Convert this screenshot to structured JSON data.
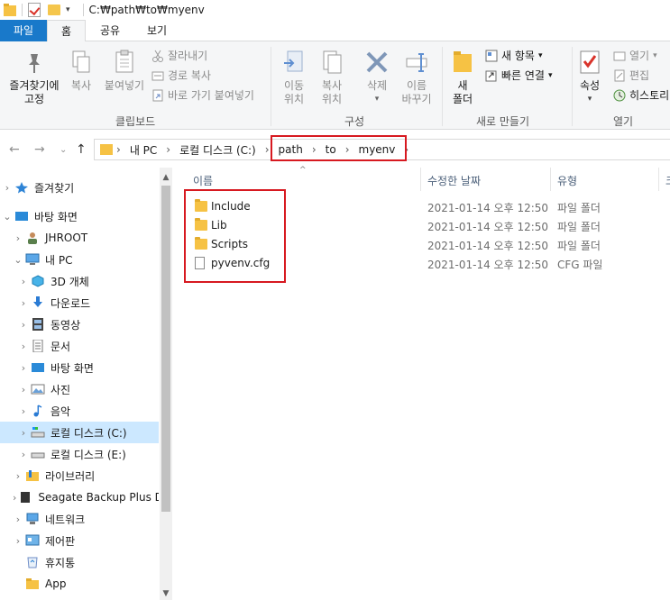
{
  "window": {
    "title": "C:₩path₩to₩myenv"
  },
  "tabs": {
    "file": "파일",
    "home": "홈",
    "share": "공유",
    "view": "보기"
  },
  "ribbon": {
    "clipboard": {
      "label": "클립보드",
      "pin_line1": "즐겨찾기에",
      "pin_line2": "고정",
      "copy": "복사",
      "paste": "붙여넣기",
      "cut": "잘라내기",
      "copy_path": "경로 복사",
      "paste_shortcut": "바로 가기 붙여넣기"
    },
    "organize": {
      "label": "구성",
      "move_line1": "이동",
      "move_line2": "위치",
      "copyto_line1": "복사",
      "copyto_line2": "위치",
      "delete": "삭제",
      "rename_line1": "이름",
      "rename_line2": "바꾸기"
    },
    "new": {
      "label": "새로 만들기",
      "folder_line1": "새",
      "folder_line2": "폴더",
      "new_item": "새 항목",
      "easy_access": "빠른 연결"
    },
    "open": {
      "label": "열기",
      "properties": "속성",
      "open": "열기",
      "edit": "편집",
      "history": "히스토리"
    }
  },
  "address": {
    "crumbs": [
      "내 PC",
      "로컬 디스크 (C:)",
      "path",
      "to",
      "myenv"
    ]
  },
  "nav": {
    "items": [
      {
        "label": "즐겨찾기",
        "icon": "star-icon"
      },
      {
        "label": "바탕 화면",
        "icon": "desktop-icon"
      },
      {
        "label": "JHROOT",
        "icon": "user-icon"
      },
      {
        "label": "내 PC",
        "icon": "computer-icon"
      },
      {
        "label": "3D 개체",
        "icon": "cube-icon"
      },
      {
        "label": "다운로드",
        "icon": "download-icon"
      },
      {
        "label": "동영상",
        "icon": "film-icon"
      },
      {
        "label": "문서",
        "icon": "document-icon"
      },
      {
        "label": "바탕 화면",
        "icon": "desktop-icon"
      },
      {
        "label": "사진",
        "icon": "picture-icon"
      },
      {
        "label": "음악",
        "icon": "music-icon"
      },
      {
        "label": "로컬 디스크 (C:)",
        "icon": "drive-icon"
      },
      {
        "label": "로컬 디스크 (E:)",
        "icon": "drive-icon"
      },
      {
        "label": "라이브러리",
        "icon": "library-icon"
      },
      {
        "label": "Seagate Backup Plus D",
        "icon": "drive-icon"
      },
      {
        "label": "네트워크",
        "icon": "network-icon"
      },
      {
        "label": "제어판",
        "icon": "control-panel-icon"
      },
      {
        "label": "휴지통",
        "icon": "recycle-bin-icon"
      },
      {
        "label": "App",
        "icon": "folder-icon"
      }
    ]
  },
  "columns": {
    "name": "이름",
    "date": "수정한 날짜",
    "type": "유형",
    "size": "크"
  },
  "files": [
    {
      "name": "Include",
      "date": "2021-01-14 오후 12:50",
      "type": "파일 폴더",
      "icon": "folder-icon"
    },
    {
      "name": "Lib",
      "date": "2021-01-14 오후 12:50",
      "type": "파일 폴더",
      "icon": "folder-icon"
    },
    {
      "name": "Scripts",
      "date": "2021-01-14 오후 12:50",
      "type": "파일 폴더",
      "icon": "folder-icon"
    },
    {
      "name": "pyvenv.cfg",
      "date": "2021-01-14 오후 12:50",
      "type": "CFG 파일",
      "icon": "file-icon"
    }
  ],
  "colors": {
    "accent": "#1979ca",
    "highlight": "#d71920",
    "selected": "#cce8ff",
    "folder": "#f6c244"
  }
}
